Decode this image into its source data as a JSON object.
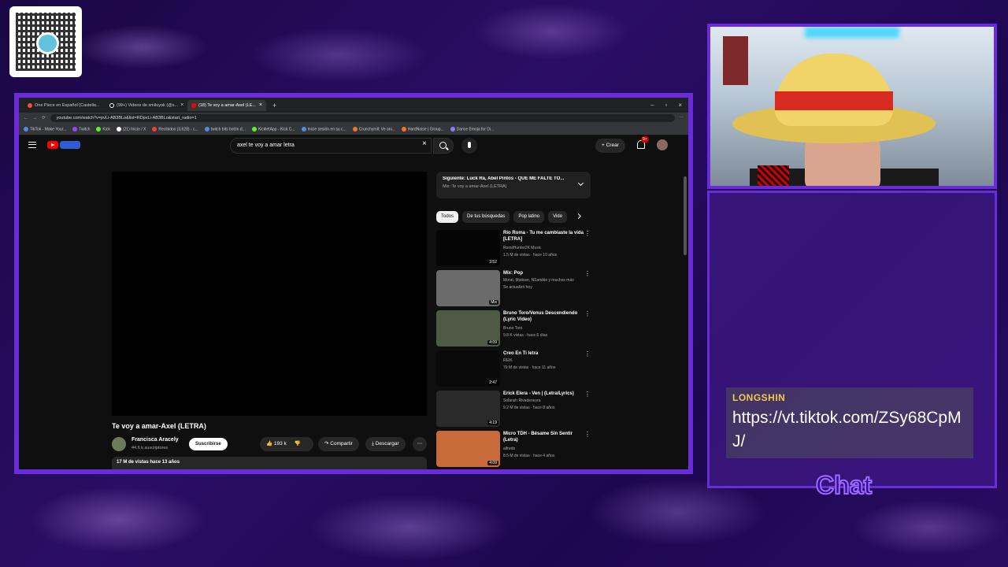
{
  "browser": {
    "tabs": [
      {
        "label": "One Piece en Español (Castella...",
        "active": false
      },
      {
        "label": "(99+) Videos de smiluyok (@s...",
        "active": false
      },
      {
        "label": "(18) Te voy a amar-Axel (LE...",
        "active": true
      }
    ],
    "url": "youtube.com/watch?v=pvLi-AB3BLo&list=RDpvLi-AB3BLo&start_radio=1",
    "bookmarks": [
      "TikTok - Make Your...",
      "Twitch",
      "Kick",
      "(21) Inicio / X",
      "Recibidos (3,628) - c...",
      "twitch bits botón d...",
      "KickletApp - Kick C...",
      "Inicie sesión en su c...",
      "Crunchyroll: Ve ani...",
      "HardNoise | Group...",
      "Dance Emoja for Di..."
    ]
  },
  "youtube": {
    "search_query": "axel te voy a amar letra",
    "create_label": "Crear",
    "notifications_count": "9+",
    "video": {
      "title": "Te voy a amar-Axel (LETRA)",
      "channel": "Francisca Aracely",
      "subscribers": "44.6 k suscriptores",
      "subscribe_label": "Suscribirse",
      "likes": "193 k",
      "share_label": "Compartir",
      "download_label": "Descargar",
      "views_date": "17 M de vistas  hace 13 años"
    },
    "next": {
      "title": "Siguiente: Luck Ra, Abel Pintos - QUE ME FALTE TO...",
      "subtitle": "Mix: Te voy a amar-Axel (LETRA)"
    },
    "chips": [
      "Todos",
      "De tus búsquedas",
      "Pop latino",
      "Vide"
    ],
    "recommendations": [
      {
        "title": "Río Roma - Tu me cambiaste la vida [LETRA]",
        "channel": "RomiiHunter2K Music",
        "meta": "1.5 M de vistas · hace 10 años",
        "duration": "3:52",
        "thumb_color": "#050505"
      },
      {
        "title": "Mix: Pop",
        "channel": "Morat, Matisse, NSamble y muchos más",
        "meta": "Se actualizó hoy",
        "duration": "Mix",
        "thumb_color": "#6b6b6b"
      },
      {
        "title": "Bruno Toro/Venus Descendiendo (Lyric Video)",
        "channel": "Bruno Toro",
        "meta": "9.8 K vistas · hace 6 días",
        "duration": "4:09",
        "thumb_color": "#4f5a46"
      },
      {
        "title": "Creo En Ti letra",
        "channel": "REIK",
        "meta": "79 M de vistas · hace 11 años",
        "duration": "2:47",
        "thumb_color": "#0a0a0a"
      },
      {
        "title": "Erick Elera - Ven | (Letra/Lyrics)",
        "channel": "Solansh Rivadeneyra",
        "meta": "9.2 M de vistas · hace 8 años",
        "duration": "4:19",
        "thumb_color": "#2a2a2a"
      },
      {
        "title": "Micro TDH - Bésame Sin Sentir (Letra)",
        "channel": "alfredo",
        "meta": "8.5 M de vistas · hace 4 años",
        "duration": "4:09",
        "thumb_color": "#c86a3a"
      }
    ]
  },
  "chat": {
    "username": "LONGSHIN",
    "message": "https://vt.tiktok.com/ZSy68CpMJ/",
    "panel_label": "Chat"
  }
}
